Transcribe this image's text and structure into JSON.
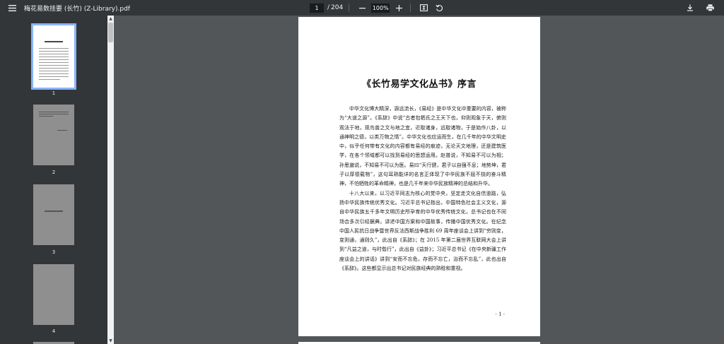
{
  "toolbar": {
    "title": "梅花易数挂要 (长竹) (Z-Library).pdf",
    "current_page": "1",
    "page_sep": "/",
    "total_pages": "204",
    "zoom": "100%"
  },
  "icons": {
    "menu": "menu-icon",
    "zoom_out": "minus-icon",
    "zoom_in": "plus-icon",
    "fit": "fit-page-icon",
    "rotate": "rotate-icon",
    "download": "download-icon",
    "print": "print-icon"
  },
  "sidebar": {
    "thumbnails": [
      {
        "label": "1"
      },
      {
        "label": "2"
      },
      {
        "label": "3"
      },
      {
        "label": "4"
      }
    ]
  },
  "document": {
    "heading": "《长竹易学文化丛书》序言",
    "paragraphs": [
      "中华文化博大精深，源远流长，《易经》是中华文化中重要的内容，被称为“大道之源”。《系辞》中说“古者包牺氏之王天下也，仰则观象于天，俯则观法于地，观鸟兽之文与地之宜，近取诸身，远取诸物，于是始作八卦，以通神明之德，以类万物之情”。中华文化也应运而生，在几千年的中华文明史中，似乎任何带有文化的内容都有易经的痕迹，无论天文地理，还是建筑医学，在各个领域都可以找到易经的思想运用。赵普说，不知易不可以为相；孙思邈说，不知易不可以为医。易曰“天行健，君子以自强不息；地势坤，君子以厚德载物”，这句耳熟能详的名言正体现了中华民族不屈不挠的奋斗精神，不怕牺牲的革命精神，也是几千年来中华民族精神的总结和升华。",
      "十八大以来，以习近平同志为核心的党中央，坚定走文化自信道路，弘扬中华民族传统优秀文化。习近平总书记指出，中国特色社会主义文化，源自中华民族五千多年文明历史所孕育的中华优秀传统文化，总书记也在不同场合多次引经据典，讲述中国方案和中国故事，传播中国优秀文化。在纪念中国人民抗日战争暨世界反法西斯战争胜利 69 周年座谈会上讲到“穷则变，变则通，通则久”，此出自《系辞》；在 2015 年第二届世界互联网大会上讲到“凡益之道，与时偕行”，此出自《益卦》；习近平总书记《在中央新疆工作座谈会上的讲话》讲到“安而不忘危，存而不忘亡，治而不忘乱”，此也出自《系辞》。这些都显示出总书记对民族经典的熟稔和重视。"
    ],
    "page_number": "· 1 ·"
  }
}
